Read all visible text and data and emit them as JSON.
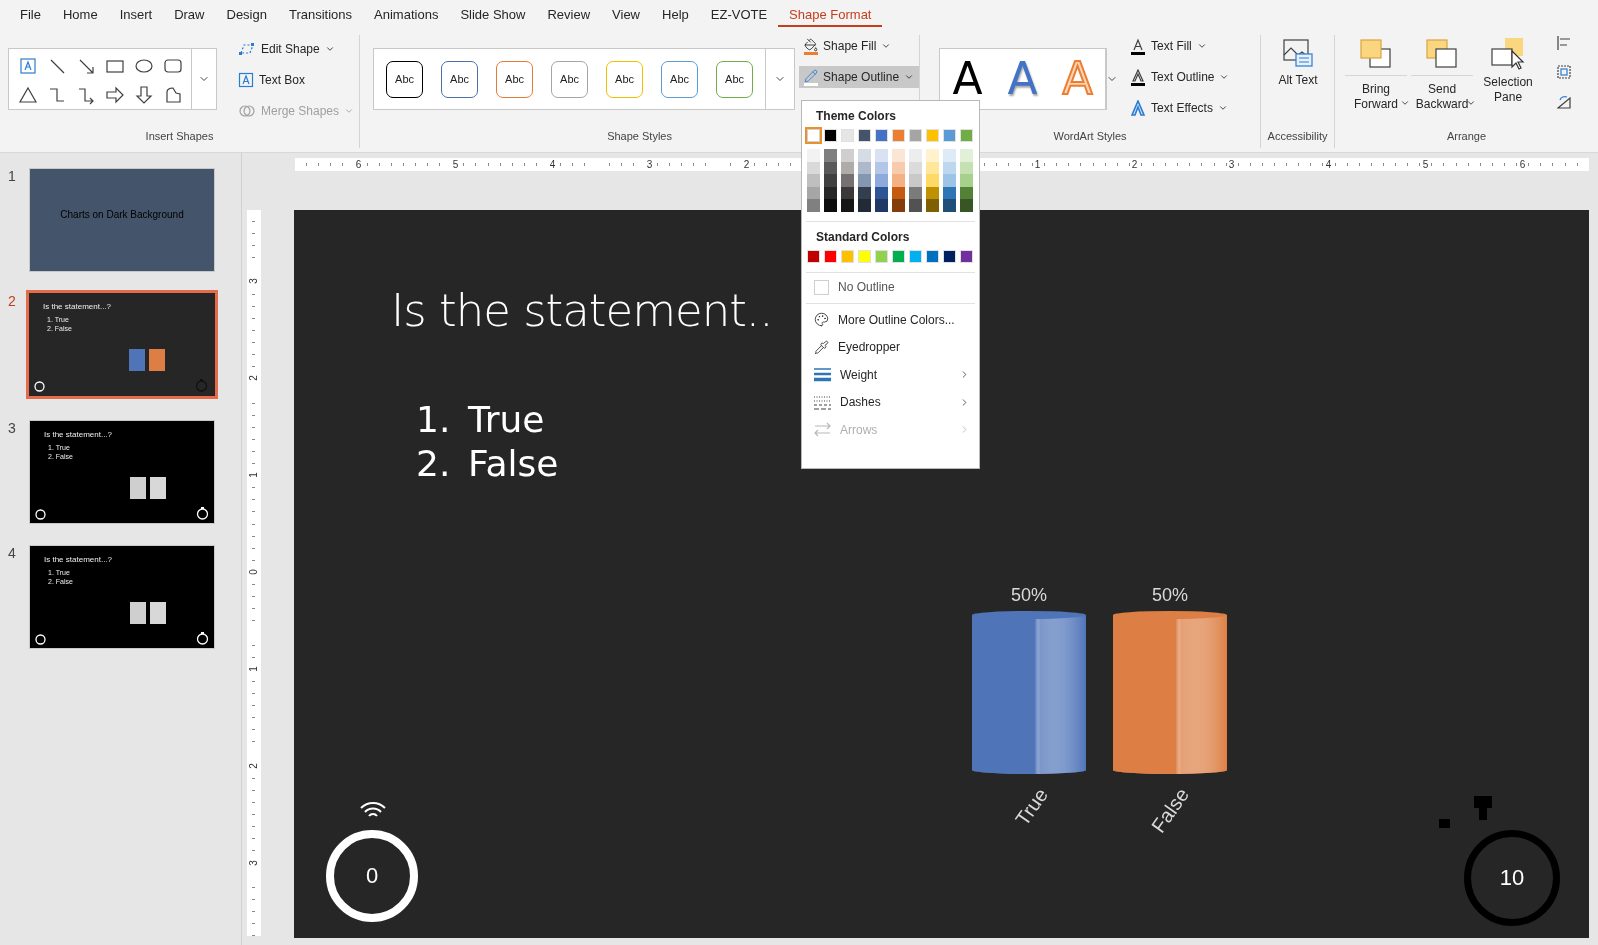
{
  "menu_tabs": [
    {
      "label": "File",
      "selected": false
    },
    {
      "label": "Home",
      "selected": false
    },
    {
      "label": "Insert",
      "selected": false
    },
    {
      "label": "Draw",
      "selected": false
    },
    {
      "label": "Design",
      "selected": false
    },
    {
      "label": "Transitions",
      "selected": false
    },
    {
      "label": "Animations",
      "selected": false
    },
    {
      "label": "Slide Show",
      "selected": false
    },
    {
      "label": "Review",
      "selected": false
    },
    {
      "label": "View",
      "selected": false
    },
    {
      "label": "Help",
      "selected": false
    },
    {
      "label": "EZ-VOTE",
      "selected": false
    },
    {
      "label": "Shape Format",
      "selected": true
    }
  ],
  "ribbon": {
    "insert_shapes": {
      "buttons": [
        {
          "kind": "edit",
          "label": "Edit Shape",
          "menu": true,
          "disabled": false
        },
        {
          "kind": "textbox",
          "label": "Text Box",
          "menu": false,
          "disabled": false
        },
        {
          "kind": "merge",
          "label": "Merge Shapes",
          "menu": true,
          "disabled": true
        }
      ],
      "group_label": "Insert Shapes"
    },
    "shape_styles": {
      "presets": [
        {
          "label": "Abc",
          "color": "#000000"
        },
        {
          "label": "Abc",
          "color": "#4f6fa8"
        },
        {
          "label": "Abc",
          "color": "#e07b39"
        },
        {
          "label": "Abc",
          "color": "#a5a5a5"
        },
        {
          "label": "Abc",
          "color": "#f0c000"
        },
        {
          "label": "Abc",
          "color": "#5b9bd5"
        },
        {
          "label": "Abc",
          "color": "#70ad47"
        }
      ],
      "fill": {
        "label": "Shape Fill",
        "pressed": false
      },
      "outline": {
        "label": "Shape Outline",
        "pressed": true
      },
      "group_label": "Shape Styles"
    },
    "wordart_styles": {
      "presets": [
        {
          "label": "A",
          "kind": "solid"
        },
        {
          "label": "A",
          "kind": "shadow"
        },
        {
          "label": "A",
          "kind": "outline"
        }
      ],
      "buttons": [
        {
          "kind": "fill",
          "label": "Text Fill"
        },
        {
          "kind": "outline",
          "label": "Text Outline"
        },
        {
          "kind": "effects",
          "label": "Text Effects"
        }
      ],
      "group_label": "WordArt Styles"
    },
    "accessibility": {
      "button": "Alt Text",
      "group_label": "Accessibility"
    },
    "arrange": {
      "buttons": [
        {
          "kind": "forward",
          "label": "Bring Forward",
          "menu": true
        },
        {
          "kind": "backward",
          "label": "Send Backward",
          "menu": true
        },
        {
          "kind": "pane",
          "label": "Selection Pane",
          "menu": false
        }
      ],
      "group_label": "Arrange"
    }
  },
  "slides": [
    {
      "number": "1",
      "selected": false,
      "kind": "title",
      "title": "Charts on Dark Background"
    },
    {
      "number": "2",
      "selected": true,
      "kind": "colored",
      "title": "Is the statement...?",
      "items": [
        "1. True",
        "2. False"
      ]
    },
    {
      "number": "3",
      "selected": false,
      "kind": "gray",
      "title": "Is the statement...?",
      "items": [
        "1. True",
        "2. False"
      ]
    },
    {
      "number": "4",
      "selected": false,
      "kind": "gray",
      "title": "Is the statement...?",
      "items": [
        "1. True",
        "2. False"
      ]
    }
  ],
  "ruler": {
    "left_labels": [
      "6",
      "5",
      "4",
      "3",
      "2"
    ],
    "right_labels": [
      "1",
      "2",
      "3",
      "4",
      "5",
      "6"
    ],
    "vertical_labels": [
      "3",
      "2",
      "1",
      "0",
      "1",
      "2",
      "3"
    ]
  },
  "slide": {
    "title": "Is the statement..",
    "items": [
      {
        "number": "1.",
        "text": "True"
      },
      {
        "number": "2.",
        "text": "False"
      }
    ],
    "chart_data": {
      "type": "bar",
      "categories": [
        "True",
        "False"
      ],
      "values": [
        50,
        50
      ],
      "value_labels": [
        "50%",
        "50%"
      ]
    },
    "vote_count": "0",
    "timer": "10"
  },
  "outline_menu": {
    "theme_heading": "Theme Colors",
    "theme_colors": [
      {
        "color": "#ffffff",
        "selected": true
      },
      {
        "color": "#000000",
        "selected": false
      },
      {
        "color": "#e7e6e6",
        "selected": false
      },
      {
        "color": "#44546a",
        "selected": false
      },
      {
        "color": "#4472c4",
        "selected": false
      },
      {
        "color": "#ed7d31",
        "selected": false
      },
      {
        "color": "#a5a5a5",
        "selected": false
      },
      {
        "color": "#ffc000",
        "selected": false
      },
      {
        "color": "#5b9bd5",
        "selected": false
      },
      {
        "color": "#70ad47",
        "selected": false
      }
    ],
    "shades": [
      {
        "tints": [
          {
            "color": "#f2f2f2"
          },
          {
            "color": "#d9d9d9"
          },
          {
            "color": "#bfbfbf"
          },
          {
            "color": "#a6a6a6"
          },
          {
            "color": "#808080"
          }
        ]
      },
      {
        "tints": [
          {
            "color": "#7f7f7f"
          },
          {
            "color": "#595959"
          },
          {
            "color": "#404040"
          },
          {
            "color": "#262626"
          },
          {
            "color": "#0d0d0d"
          }
        ]
      },
      {
        "tints": [
          {
            "color": "#d0cece"
          },
          {
            "color": "#aeabab"
          },
          {
            "color": "#757171"
          },
          {
            "color": "#3a3838"
          },
          {
            "color": "#171616"
          }
        ]
      },
      {
        "tints": [
          {
            "color": "#d6dce4"
          },
          {
            "color": "#adb9ca"
          },
          {
            "color": "#8497b0"
          },
          {
            "color": "#333f4f"
          },
          {
            "color": "#222a35"
          }
        ]
      },
      {
        "tints": [
          {
            "color": "#d9e2f3"
          },
          {
            "color": "#b4c6e7"
          },
          {
            "color": "#8eaadb"
          },
          {
            "color": "#2f5496"
          },
          {
            "color": "#1f3864"
          }
        ]
      },
      {
        "tints": [
          {
            "color": "#fbe5d5"
          },
          {
            "color": "#f7cbac"
          },
          {
            "color": "#f4b183"
          },
          {
            "color": "#c55a11"
          },
          {
            "color": "#843c0b"
          }
        ]
      },
      {
        "tints": [
          {
            "color": "#ededed"
          },
          {
            "color": "#dbdbdb"
          },
          {
            "color": "#c9c9c9"
          },
          {
            "color": "#7b7b7b"
          },
          {
            "color": "#525252"
          }
        ]
      },
      {
        "tints": [
          {
            "color": "#fff2cc"
          },
          {
            "color": "#ffe699"
          },
          {
            "color": "#ffd966"
          },
          {
            "color": "#bf9000"
          },
          {
            "color": "#7f6000"
          }
        ]
      },
      {
        "tints": [
          {
            "color": "#deebf6"
          },
          {
            "color": "#bdd7ee"
          },
          {
            "color": "#9dc3e6"
          },
          {
            "color": "#2e75b5"
          },
          {
            "color": "#1f4e79"
          }
        ]
      },
      {
        "tints": [
          {
            "color": "#e2efd9"
          },
          {
            "color": "#c5e0b3"
          },
          {
            "color": "#a8d08d"
          },
          {
            "color": "#538135"
          },
          {
            "color": "#375623"
          }
        ]
      }
    ],
    "standard_heading": "Standard Colors",
    "standard_colors": [
      {
        "color": "#c00000"
      },
      {
        "color": "#ff0000"
      },
      {
        "color": "#ffc000"
      },
      {
        "color": "#ffff00"
      },
      {
        "color": "#92d050"
      },
      {
        "color": "#00b050"
      },
      {
        "color": "#00b0f0"
      },
      {
        "color": "#0070c0"
      },
      {
        "color": "#002060"
      },
      {
        "color": "#7030a0"
      }
    ],
    "no_outline": "No Outline",
    "items": [
      {
        "kind": "palette",
        "label": "More Outline Colors...",
        "submenu": false,
        "disabled": false
      },
      {
        "kind": "eyedropper",
        "label": "Eyedropper",
        "submenu": false,
        "disabled": false
      },
      {
        "kind": "weight",
        "label": "Weight",
        "submenu": true,
        "disabled": false
      },
      {
        "kind": "dashes",
        "label": "Dashes",
        "submenu": true,
        "disabled": false
      },
      {
        "kind": "arrows",
        "label": "Arrows",
        "submenu": true,
        "disabled": true
      }
    ]
  }
}
